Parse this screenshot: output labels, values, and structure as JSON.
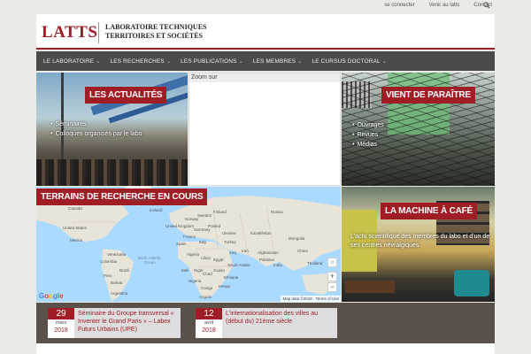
{
  "topbar": {
    "links": [
      "se connecter",
      "Venir au latts",
      "Contact"
    ]
  },
  "header": {
    "logo": "LATTS",
    "subtitle_line1": "LABORATOIRE TECHNIQUES",
    "subtitle_line2": "TERRITOIRES ET SOCIÉTÉS"
  },
  "nav": {
    "items": [
      "LE LABORATOIRE",
      "LES RECHERCHES",
      "LES PUBLICATIONS",
      "LES MEMBRES",
      "LE CURSUS DOCTORAL"
    ]
  },
  "tiles": {
    "actualites": {
      "label": "LES ACTUALITÉS",
      "links": [
        "Séminaires",
        "Colloques organisés par le labo"
      ]
    },
    "zoom": {
      "label": "Zoom sur"
    },
    "vient": {
      "label": "VIENT DE PARAÎTRE",
      "links": [
        "Ouvrages",
        "Revues",
        "Médias"
      ]
    },
    "terrains": {
      "label": "TERRAINS DE RECHERCHE EN COURS",
      "map_labels": [
        "Greenland",
        "Iceland",
        "Sweden",
        "Finland",
        "Norway",
        "Russia",
        "United Kingdom",
        "Germany",
        "Poland",
        "Ukraine",
        "France",
        "Spain",
        "Italy",
        "Turkey",
        "Kazakhstan",
        "Mongolia",
        "China",
        "Iran",
        "Afghanistan",
        "Pakistan",
        "India",
        "Iraq",
        "Saudi Arabia",
        "Egypt",
        "Algeria",
        "Libya",
        "Mali",
        "Niger",
        "Chad",
        "Sudan",
        "Nigeria",
        "Ethiopia",
        "Kenya",
        "Congo",
        "Angola",
        "Canada",
        "United States",
        "Mexico",
        "Venezuela",
        "Colombia",
        "Brazil",
        "Peru",
        "Bolivia",
        "Argentina",
        "North Atlantic Ocean",
        "Thailand",
        "Mali"
      ],
      "map_controls": {
        "zoom_in": "+",
        "zoom_out": "−"
      },
      "attribution": "Map data ©2018",
      "terms": "Terms of Use",
      "google": "Google"
    },
    "cafe": {
      "label": "LA MACHINE À CAFÉ",
      "text": "L'actu scientifique des membres du labo et d'un de ses centres névralgiques"
    }
  },
  "events": [
    {
      "day": "29",
      "month": "mars",
      "year": "2018",
      "title": "Séminaire du Groupe transversal « Inventer le Grand Paris » – Labex Futurs Urbains (UPE)"
    },
    {
      "day": "12",
      "month": "avril",
      "year": "2018",
      "title": "L'internationalisation des villes au (début du) 21ème siècle"
    }
  ],
  "colors": {
    "accent": "#a01d26",
    "nav_bg": "#4b4b4b",
    "events_bg": "#5a514b",
    "map_water": "#aadaff",
    "map_land": "#e8e4d8"
  },
  "icons": {
    "search": "search-icon",
    "chevron": "chevron-down-icon"
  }
}
